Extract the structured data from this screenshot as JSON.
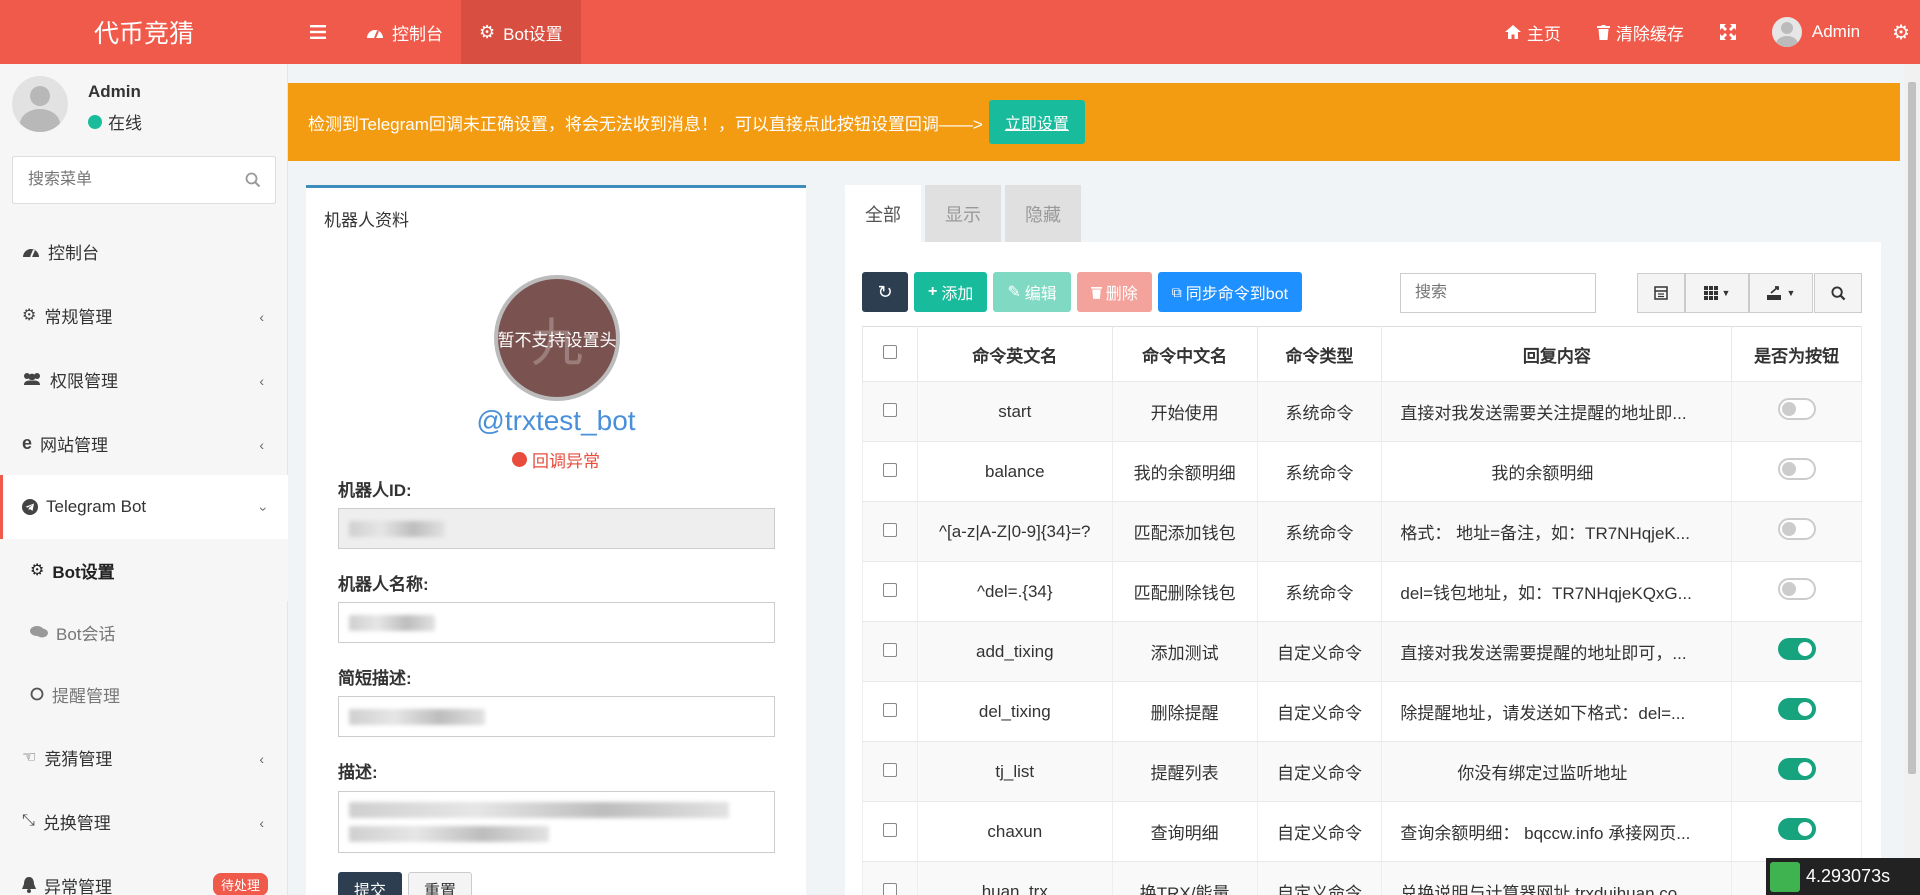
{
  "header": {
    "brand": "代币竞猜",
    "nav": [
      {
        "label": "控制台",
        "icon": "dashboard-icon"
      },
      {
        "label": "Bot设置",
        "icon": "gear-icon"
      }
    ],
    "right": [
      {
        "label": "主页",
        "icon": "home-icon"
      },
      {
        "label": "清除缓存",
        "icon": "trash-icon"
      },
      {
        "label": "",
        "icon": "fullscreen-icon"
      },
      {
        "label": "Admin",
        "icon": "avatar"
      },
      {
        "label": "",
        "icon": "gears-icon"
      }
    ],
    "colors": {
      "accent": "#f05a4b"
    }
  },
  "sidebar": {
    "user": {
      "name": "Admin",
      "status": "在线"
    },
    "search_placeholder": "搜索菜单",
    "items": [
      {
        "label": "控制台",
        "icon": "dashboard-icon"
      },
      {
        "label": "常规管理",
        "icon": "cogs-icon"
      },
      {
        "label": "权限管理",
        "icon": "group-icon"
      },
      {
        "label": "网站管理",
        "icon": "ie-icon"
      },
      {
        "label": "Telegram Bot",
        "icon": "telegram-icon"
      },
      {
        "label": "竞猜管理",
        "icon": "hand-icon"
      },
      {
        "label": "兑换管理",
        "icon": "compress-icon"
      },
      {
        "label": "异常管理",
        "icon": "bell-icon",
        "badge": "待处理"
      }
    ],
    "subitems": [
      {
        "label": "Bot设置",
        "icon": "gear-icon"
      },
      {
        "label": "Bot会话",
        "icon": "comments-icon"
      },
      {
        "label": "提醒管理",
        "icon": "circle-icon"
      }
    ]
  },
  "alert": {
    "text": "检测到Telegram回调未正确设置，将会无法收到消息！，可以直接点此按钮设置回调——>",
    "button": "立即设置"
  },
  "bot_panel": {
    "title": "机器人资料",
    "avatar_text": "暂不支持设置头",
    "avatar_ghost": "九",
    "handle": "@trxtest_bot",
    "status": "回调异常",
    "fields": {
      "id_label": "机器人ID:",
      "name_label": "机器人名称:",
      "short_label": "简短描述:",
      "desc_label": "描述:"
    },
    "submit": "提交",
    "reset": "重置"
  },
  "cmd_panel": {
    "tabs": [
      "全部",
      "显示",
      "隐藏"
    ],
    "toolbar": {
      "add": "添加",
      "edit": "编辑",
      "delete": "删除",
      "sync": "同步命令到bot"
    },
    "search_placeholder": "搜索",
    "columns": [
      "命令英文名",
      "命令中文名",
      "命令类型",
      "回复内容",
      "是否为按钮"
    ],
    "rows": [
      {
        "en": "start",
        "zh": "开始使用",
        "type": "系统命令",
        "reply": "直接对我发送需要关注提醒的地址即...",
        "button": false
      },
      {
        "en": "balance",
        "zh": "我的余额明细",
        "type": "系统命令",
        "reply": "我的余额明细",
        "button": false
      },
      {
        "en": "^[a-z|A-Z|0-9]{34}=?",
        "zh": "匹配添加钱包",
        "type": "系统命令",
        "reply": "格式： 地址=备注，如：TR7NHqjeK...",
        "button": false
      },
      {
        "en": "^del=.{34}",
        "zh": "匹配删除钱包",
        "type": "系统命令",
        "reply": "del=钱包地址，如：TR7NHqjeKQxG...",
        "button": false
      },
      {
        "en": "add_tixing",
        "zh": "添加测试",
        "type": "自定义命令",
        "reply": "直接对我发送需要提醒的地址即可，...",
        "button": true
      },
      {
        "en": "del_tixing",
        "zh": "删除提醒",
        "type": "自定义命令",
        "reply": "除提醒地址，请发送如下格式：del=...",
        "button": true
      },
      {
        "en": "tj_list",
        "zh": "提醒列表",
        "type": "自定义命令",
        "reply": "你没有绑定过监听地址",
        "button": true
      },
      {
        "en": "chaxun",
        "zh": "查询明细",
        "type": "自定义命令",
        "reply": "查询余额明细： bqccw.info 承接网页...",
        "button": true
      },
      {
        "en": "huan_trx",
        "zh": "换TRX/能量",
        "type": "自定义命令",
        "reply": "兑换说明与计算器网址 trxduihuan.co...",
        "button": true
      }
    ]
  },
  "timer": "4.293073s"
}
